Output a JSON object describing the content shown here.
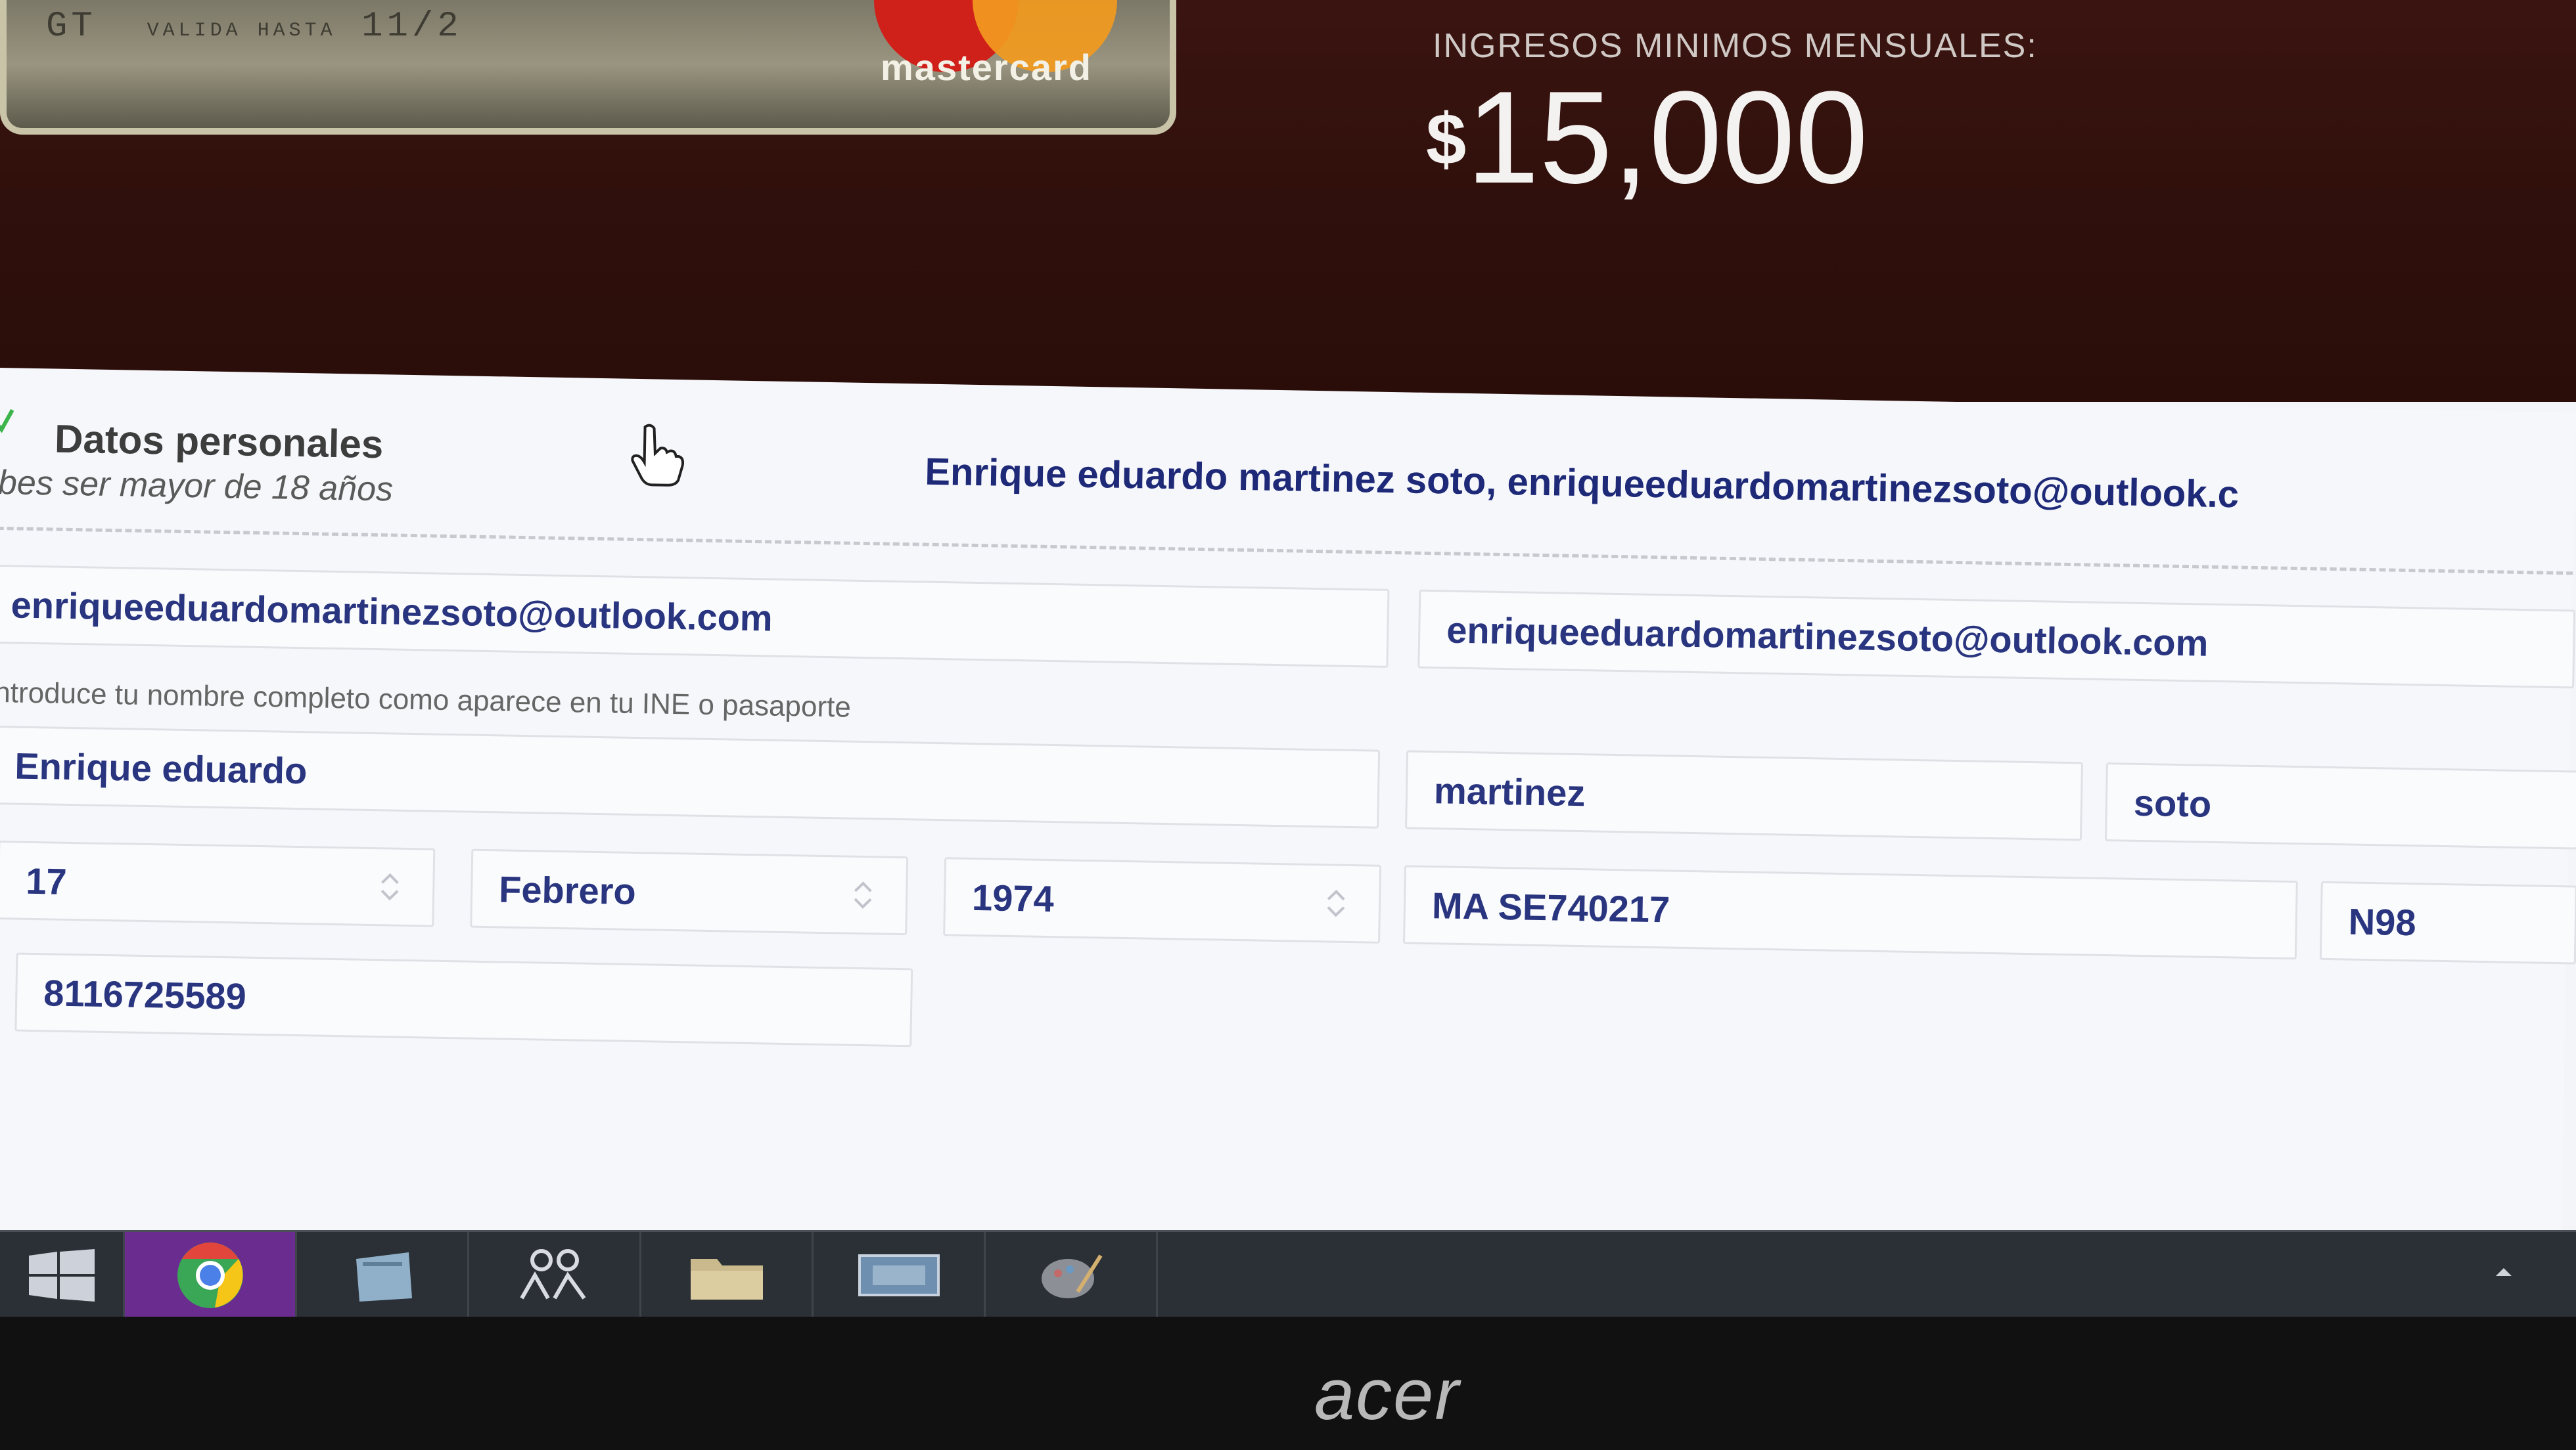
{
  "card": {
    "number_fragment": "GT",
    "valid_label": "VALIDA HASTA",
    "expiry": "11/2",
    "brand_word": "mastercard"
  },
  "hero": {
    "income_label": "INGRESOS MINIMOS MENSUALES:",
    "currency_symbol": "$",
    "income_value": "15,000"
  },
  "form": {
    "section_title": "Datos personales",
    "section_subtitle": "bes ser mayor de 18 años",
    "summary": "Enrique eduardo martinez soto, enriqueeduardomartinezsoto@outlook.c",
    "email": "enriqueeduardomartinezsoto@outlook.com",
    "email_confirm": "enriqueeduardomartinezsoto@outlook.com",
    "name_hint": "ntroduce tu nombre completo como aparece en tu INE o pasaporte",
    "first_names": "Enrique eduardo",
    "paternal_surname": "martinez",
    "maternal_surname": "soto",
    "birth_day": "17",
    "birth_month": "Febrero",
    "birth_year": "1974",
    "rfc": "MA SE740217",
    "homoclave": "N98",
    "phone": "8116725589"
  },
  "taskbar": {
    "items": [
      "windows-start",
      "chrome",
      "notepad",
      "people",
      "file-explorer",
      "screenshot-tool",
      "paint"
    ]
  },
  "monitor": {
    "brand": "acer"
  },
  "colors": {
    "hero_bg": "#2e0f0b",
    "accent_text": "#1e2a78",
    "panel_bg": "#f6f7fb"
  }
}
